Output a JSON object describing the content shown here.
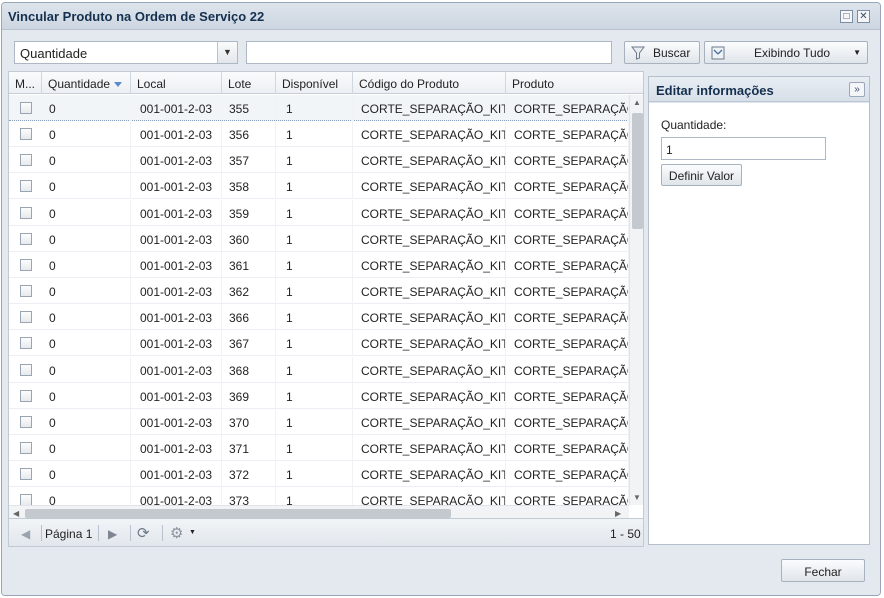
{
  "window": {
    "title": "Vincular Produto na Ordem de Serviço 22"
  },
  "toolbar": {
    "field_selected": "Quantidade",
    "search_value": "",
    "search_label": "Buscar",
    "view_label": "Exibindo Tudo"
  },
  "grid": {
    "columns": [
      "M...",
      "Quantidade",
      "Local",
      "Lote",
      "Disponível",
      "Código do Produto",
      "Produto"
    ],
    "rows": [
      {
        "qtd": "0",
        "local": "001-001-2-03",
        "lote": "355",
        "disp": "1",
        "codigo": "CORTE_SEPARAÇÃO_KIT",
        "produto": "CORTE_SEPARAÇÃO_"
      },
      {
        "qtd": "0",
        "local": "001-001-2-03",
        "lote": "356",
        "disp": "1",
        "codigo": "CORTE_SEPARAÇÃO_KIT",
        "produto": "CORTE_SEPARAÇÃO_"
      },
      {
        "qtd": "0",
        "local": "001-001-2-03",
        "lote": "357",
        "disp": "1",
        "codigo": "CORTE_SEPARAÇÃO_KIT",
        "produto": "CORTE_SEPARAÇÃO_"
      },
      {
        "qtd": "0",
        "local": "001-001-2-03",
        "lote": "358",
        "disp": "1",
        "codigo": "CORTE_SEPARAÇÃO_KIT",
        "produto": "CORTE_SEPARAÇÃO_"
      },
      {
        "qtd": "0",
        "local": "001-001-2-03",
        "lote": "359",
        "disp": "1",
        "codigo": "CORTE_SEPARAÇÃO_KIT",
        "produto": "CORTE_SEPARAÇÃO_"
      },
      {
        "qtd": "0",
        "local": "001-001-2-03",
        "lote": "360",
        "disp": "1",
        "codigo": "CORTE_SEPARAÇÃO_KIT",
        "produto": "CORTE_SEPARAÇÃO_"
      },
      {
        "qtd": "0",
        "local": "001-001-2-03",
        "lote": "361",
        "disp": "1",
        "codigo": "CORTE_SEPARAÇÃO_KIT",
        "produto": "CORTE_SEPARAÇÃO_"
      },
      {
        "qtd": "0",
        "local": "001-001-2-03",
        "lote": "362",
        "disp": "1",
        "codigo": "CORTE_SEPARAÇÃO_KIT",
        "produto": "CORTE_SEPARAÇÃO_"
      },
      {
        "qtd": "0",
        "local": "001-001-2-03",
        "lote": "366",
        "disp": "1",
        "codigo": "CORTE_SEPARAÇÃO_KIT",
        "produto": "CORTE_SEPARAÇÃO_"
      },
      {
        "qtd": "0",
        "local": "001-001-2-03",
        "lote": "367",
        "disp": "1",
        "codigo": "CORTE_SEPARAÇÃO_KIT",
        "produto": "CORTE_SEPARAÇÃO_"
      },
      {
        "qtd": "0",
        "local": "001-001-2-03",
        "lote": "368",
        "disp": "1",
        "codigo": "CORTE_SEPARAÇÃO_KIT",
        "produto": "CORTE_SEPARAÇÃO_"
      },
      {
        "qtd": "0",
        "local": "001-001-2-03",
        "lote": "369",
        "disp": "1",
        "codigo": "CORTE_SEPARAÇÃO_KIT",
        "produto": "CORTE_SEPARAÇÃO_"
      },
      {
        "qtd": "0",
        "local": "001-001-2-03",
        "lote": "370",
        "disp": "1",
        "codigo": "CORTE_SEPARAÇÃO_KIT",
        "produto": "CORTE_SEPARAÇÃO_"
      },
      {
        "qtd": "0",
        "local": "001-001-2-03",
        "lote": "371",
        "disp": "1",
        "codigo": "CORTE_SEPARAÇÃO_KIT",
        "produto": "CORTE_SEPARAÇÃO_"
      },
      {
        "qtd": "0",
        "local": "001-001-2-03",
        "lote": "372",
        "disp": "1",
        "codigo": "CORTE_SEPARAÇÃO_KIT",
        "produto": "CORTE_SEPARAÇÃO_"
      },
      {
        "qtd": "0",
        "local": "001-001-2-03",
        "lote": "373",
        "disp": "1",
        "codigo": "CORTE_SEPARAÇÃO_KIT",
        "produto": "CORTE_SEPARAÇÃO_"
      }
    ]
  },
  "pager": {
    "page_label": "Página 1",
    "range": "1 - 50"
  },
  "edit_panel": {
    "title": "Editar informações",
    "field_label": "Quantidade:",
    "field_value": "1",
    "apply_label": "Definir Valor"
  },
  "footer": {
    "close_label": "Fechar"
  },
  "icons": {
    "window_maximize": "maximize-icon",
    "window_close": "close-icon",
    "dropdown": "chevron-down-icon",
    "search": "funnel-icon",
    "view": "filter-view-icon",
    "sort": "sort-desc-icon",
    "first_page": "first-page-icon",
    "next_page": "next-page-icon",
    "refresh": "refresh-icon",
    "settings": "gear-icon",
    "collapse": "collapse-right-icon"
  },
  "colors": {
    "accent": "#15304f",
    "sort_arrow": "#5a8ccc"
  }
}
